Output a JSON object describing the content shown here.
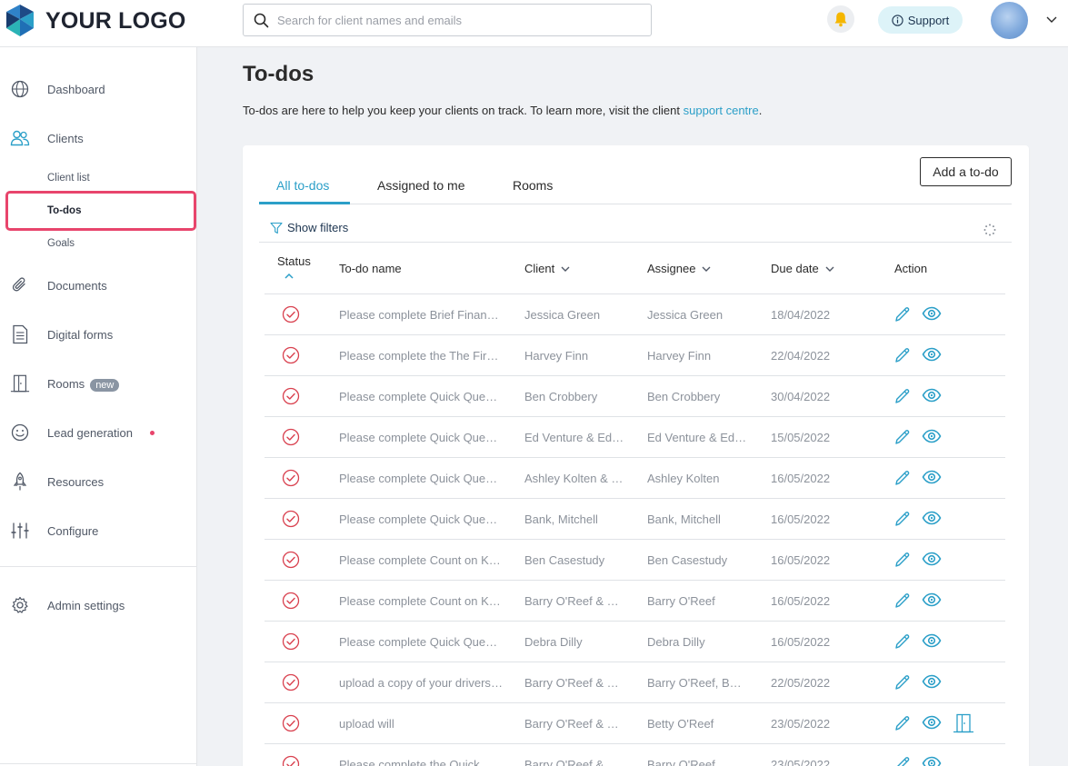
{
  "header": {
    "logo_text": "YOUR LOGO",
    "search_placeholder": "Search for client names and emails",
    "support_label": "Support"
  },
  "colors": {
    "accent": "#2b9fc8",
    "highlight": "#e8456c",
    "status_red": "#d9414f",
    "bell": "#f5b600"
  },
  "sidebar": {
    "items": [
      {
        "label": "Dashboard",
        "icon": "globe-icon"
      },
      {
        "label": "Clients",
        "icon": "users-icon"
      },
      {
        "label": "Documents",
        "icon": "paperclip-icon"
      },
      {
        "label": "Digital forms",
        "icon": "form-icon"
      },
      {
        "label": "Rooms",
        "icon": "room-icon",
        "badge": "new"
      },
      {
        "label": "Lead generation",
        "icon": "smiley-icon"
      },
      {
        "label": "Resources",
        "icon": "rocket-icon"
      },
      {
        "label": "Configure",
        "icon": "sliders-icon"
      },
      {
        "label": "Admin settings",
        "icon": "gear-icon"
      }
    ],
    "client_subitems": [
      "Client list",
      "To-dos",
      "Goals"
    ],
    "active_subitem": "To-dos"
  },
  "page": {
    "title": "To-dos",
    "intro_text": "To-dos are here to help you keep your clients on track. To learn more, visit the client ",
    "intro_link": "support centre",
    "intro_end": "."
  },
  "card": {
    "tabs": [
      "All to-dos",
      "Assigned to me",
      "Rooms"
    ],
    "active_tab": "All to-dos",
    "add_button": "Add a to-do",
    "show_filters": "Show filters"
  },
  "table": {
    "columns": [
      "Status",
      "To-do name",
      "Client",
      "Assignee",
      "Due date",
      "Action"
    ],
    "rows": [
      {
        "name": "Please complete Brief Financial Review",
        "client": "Jessica Green",
        "assignee": "Jessica Green",
        "due": "18/04/2022",
        "room": false
      },
      {
        "name": "Please complete the The Firm Fact Find",
        "client": "Harvey Finn",
        "assignee": "Harvey Finn",
        "due": "22/04/2022",
        "room": false
      },
      {
        "name": "Please complete Quick Questionnaire",
        "client": "Ben Crobbery",
        "assignee": "Ben Crobbery",
        "due": "30/04/2022",
        "room": false
      },
      {
        "name": "Please complete Quick Questionnaire",
        "client": "Ed Venture & Edwina Venture",
        "assignee": "Ed Venture & Edwina Venture",
        "due": "15/05/2022",
        "room": false
      },
      {
        "name": "Please complete Quick Questionnaire",
        "client": "Ashley Kolten & Lee Kolten",
        "assignee": "Ashley Kolten",
        "due": "16/05/2022",
        "room": false
      },
      {
        "name": "Please complete Quick Questionnaire",
        "client": "Bank, Mitchell",
        "assignee": "Bank, Mitchell",
        "due": "16/05/2022",
        "room": false
      },
      {
        "name": "Please complete Count on Klarity",
        "client": "Ben Casestudy",
        "assignee": "Ben Casestudy",
        "due": "16/05/2022",
        "room": false
      },
      {
        "name": "Please complete Count on Klarity",
        "client": "Barry O'Reef & Betty O'Reef",
        "assignee": "Barry O'Reef",
        "due": "16/05/2022",
        "room": false
      },
      {
        "name": "Please complete Quick Questionnaire",
        "client": "Debra Dilly",
        "assignee": "Debra Dilly",
        "due": "16/05/2022",
        "room": false
      },
      {
        "name": "upload a copy of your drivers licence",
        "client": "Barry O'Reef & Betty O'Reef",
        "assignee": "Barry O'Reef, Betty O'Reef",
        "due": "22/05/2022",
        "room": false
      },
      {
        "name": "upload will",
        "client": "Barry O'Reef & Betty O'Reef",
        "assignee": "Betty O'Reef",
        "due": "23/05/2022",
        "room": true
      },
      {
        "name": "Please complete the Quick Questionnaire",
        "client": "Barry O'Reef & Betty O'Reef",
        "assignee": "Barry O'Reef",
        "due": "23/05/2022",
        "room": false
      }
    ]
  }
}
